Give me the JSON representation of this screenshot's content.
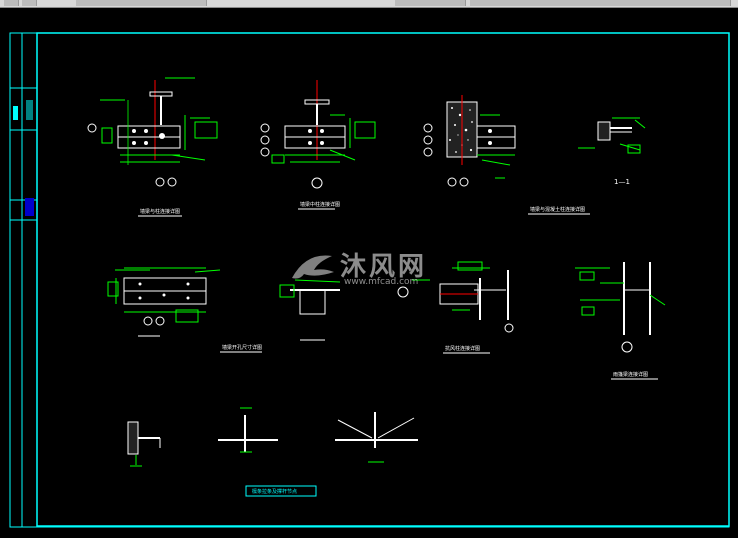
{
  "colors": {
    "background": "#000000",
    "frame": "#00ffff",
    "dimension": "#00ff00",
    "steel": "#ffffff",
    "axis": "#ff0000",
    "concrete": "#ffffff"
  },
  "labels": {
    "detail_1": "墙梁与柱连接详图",
    "detail_2": "墙梁中柱连接详图",
    "detail_3": "墙梁与混凝土柱连接详图",
    "section_1": "1—1",
    "detail_4": "墙梁开孔尺寸详图",
    "detail_5": "抗风柱连接详图",
    "detail_6": "雨篷梁连接详图",
    "detail_7": "檩条拉条及撑杆节点",
    "watermark_brand": "沐风网",
    "watermark_url": "www.mfcad.com"
  }
}
